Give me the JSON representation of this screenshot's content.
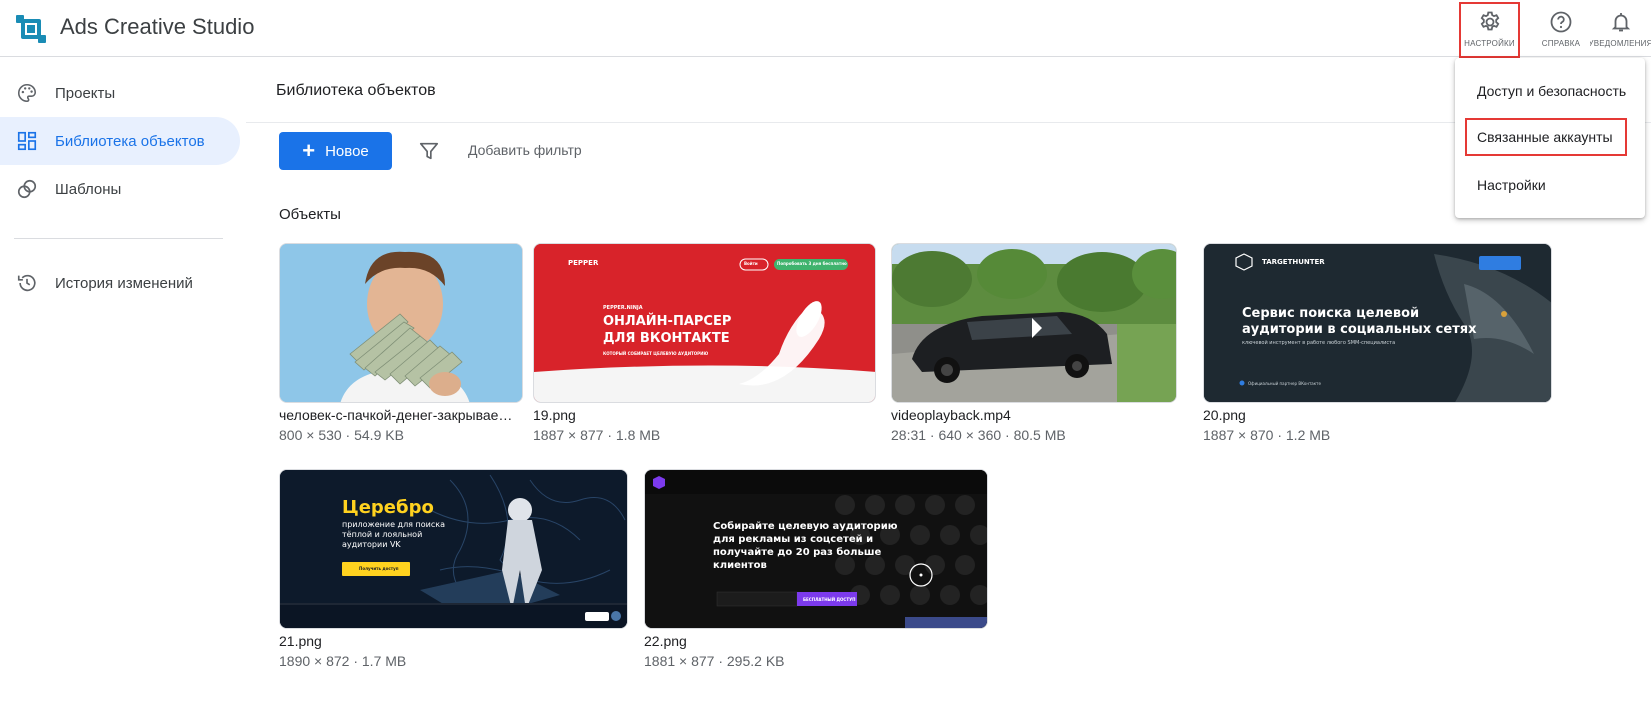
{
  "app": {
    "title": "Ads Creative Studio"
  },
  "header": {
    "settings_label": "НАСТРОЙКИ",
    "help_label": "СПРАВКА",
    "notifications_label": "УВЕДОМЛЕНИЯ"
  },
  "sidebar": {
    "items": [
      {
        "label": "Проекты",
        "icon": "palette-icon"
      },
      {
        "label": "Библиотека объектов",
        "icon": "dashboard-icon",
        "active": true
      },
      {
        "label": "Шаблоны",
        "icon": "templates-icon"
      },
      {
        "label": "История изменений",
        "icon": "history-icon"
      }
    ]
  },
  "main": {
    "title": "Библиотека объектов",
    "new_button": "Новое",
    "add_filter": "Добавить фильтр",
    "section_title": "Объекты"
  },
  "assets": [
    {
      "name": "человек-с-пачкой-денег-закрывае…",
      "meta": "800 × 530 · 54.9 KB"
    },
    {
      "name": "19.png",
      "meta": "1887 × 877 · 1.8 MB"
    },
    {
      "name": "videoplayback.mp4",
      "meta": "28:31 · 640 × 360 · 80.5 MB"
    },
    {
      "name": "20.png",
      "meta": "1887 × 870 · 1.2 MB"
    },
    {
      "name": "21.png",
      "meta": "1890 × 872 · 1.7 MB"
    },
    {
      "name": "22.png",
      "meta": "1881 × 877 · 295.2 KB"
    }
  ],
  "thumbs": {
    "t19_brand": "PEPPER",
    "t19_small": "PEPPER.NINJA",
    "t19_line1": "ОНЛАЙН-ПАРСЕР",
    "t19_line2": "ДЛЯ ВКОНТАКТЕ",
    "t19_sub": "КОТОРЫЙ СОБИРАЕТ ЦЕЛЕВУЮ АУДИТОРИЮ",
    "t19_btn1": "Войти",
    "t19_btn2": "Попробовать 3 дня бесплатно",
    "t20_brand": "TARGETHUNTER",
    "t20_line1": "Сервис поиска целевой",
    "t20_line2": "аудитории в социальных сетях",
    "t20_sub": "ключевой инструмент в работе любого SMM-специалиста",
    "t20_partner": "Официальный партнер ВКонтакте",
    "t21_title": "Церебро",
    "t21_line1": "приложение для поиска",
    "t21_line2": "тёплой и лояльной",
    "t21_line3": "аудитории VK",
    "t21_btn": "Получить доступ",
    "t22_line1": "Собирайте целевую аудиторию",
    "t22_line2": "для рекламы из соцсетей и",
    "t22_line3": "получайте до 20 раз больше",
    "t22_line4": "клиентов",
    "t22_btn": "БЕСПЛАТНЫЙ ДОСТУП"
  },
  "menu": {
    "items": [
      {
        "label": "Доступ и безопасность"
      },
      {
        "label": "Связанные аккаунты",
        "highlighted": true
      },
      {
        "label": "Настройки"
      }
    ]
  },
  "colors": {
    "accent": "#1a73e8",
    "highlight_border": "#e53935",
    "active_bg": "#e8f0fe"
  }
}
